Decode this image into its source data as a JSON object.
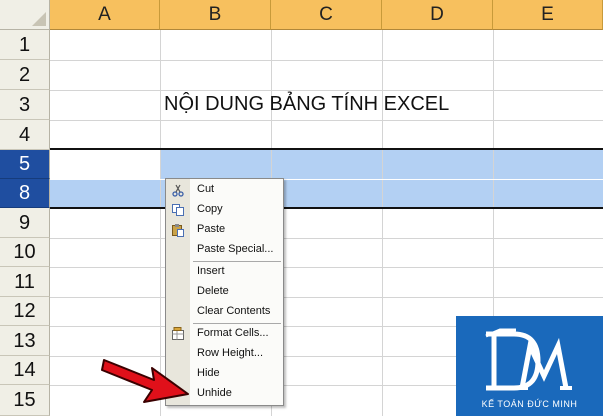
{
  "columns": [
    "A",
    "B",
    "C",
    "D",
    "E"
  ],
  "rows": [
    "1",
    "2",
    "3",
    "4",
    "5",
    "8",
    "9",
    "10",
    "11",
    "12",
    "13",
    "14",
    "15"
  ],
  "cell_b3": "NỘI DUNG BẢNG TÍNH EXCEL",
  "context_menu": {
    "cut": "Cut",
    "copy": "Copy",
    "paste": "Paste",
    "paste_special": "Paste Special...",
    "insert": "Insert",
    "delete": "Delete",
    "clear_contents": "Clear Contents",
    "format_cells": "Format Cells...",
    "row_height": "Row Height...",
    "hide": "Hide",
    "unhide": "Unhide"
  },
  "logo": {
    "caption": "KẾ TOÁN ĐỨC MINH"
  },
  "colors": {
    "column_header": "#f7c05e",
    "selected_row_header": "#1f4ea0",
    "selection": "#b3d0f3",
    "logo_bg": "#1a69bb",
    "arrow": "#e0101a"
  },
  "icons": [
    "scissors-icon",
    "copy-icon",
    "paste-icon",
    "format-cells-icon",
    "arrow-icon",
    "logo-icon"
  ]
}
